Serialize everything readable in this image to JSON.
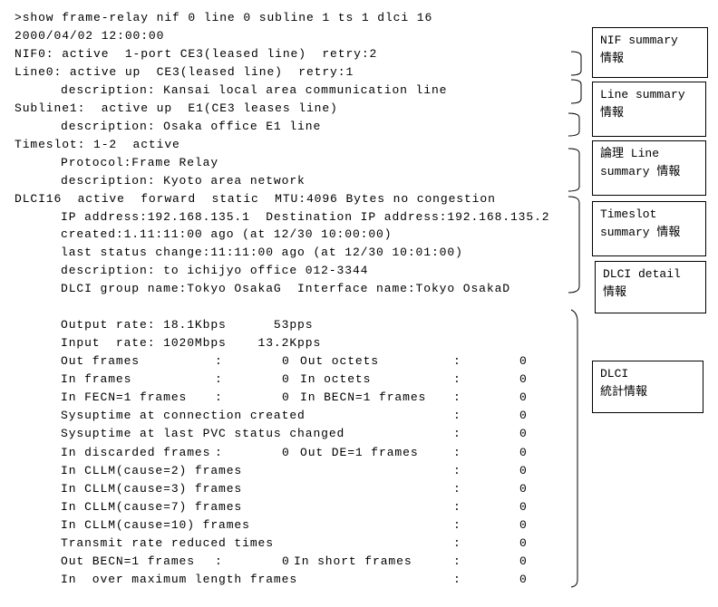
{
  "console": {
    "command": ">show frame-relay nif 0 line 0 subline 1 ts 1 dlci 16",
    "timestamp": "2000/04/02 12:00:00",
    "lines": [
      {
        "indent": false,
        "text": "NIF0: active  1-port CE3(leased line)  retry:2"
      },
      {
        "indent": false,
        "text": "Line0: active up  CE3(leased line)  retry:1"
      },
      {
        "indent": true,
        "text": "description: Kansai local area communication line"
      },
      {
        "indent": false,
        "text": "Subline1:  active up  E1(CE3 leases line)"
      },
      {
        "indent": true,
        "text": "description: Osaka office E1 line"
      },
      {
        "indent": false,
        "text": "Timeslot: 1-2  active"
      },
      {
        "indent": true,
        "text": "Protocol:Frame Relay"
      },
      {
        "indent": true,
        "text": "description: Kyoto area network"
      },
      {
        "indent": false,
        "text": "DLCI16  active  forward  static  MTU:4096 Bytes no congestion"
      },
      {
        "indent": true,
        "text": "IP address:192.168.135.1  Destination IP address:192.168.135.2"
      },
      {
        "indent": true,
        "text": "created:1.11:11:00 ago (at 12/30 10:00:00)"
      },
      {
        "indent": true,
        "text": "last status change:11:11:00 ago (at 12/30 10:01:00)"
      },
      {
        "indent": true,
        "text": "description: to ichijyo office 012-3344"
      },
      {
        "indent": true,
        "text": "DLCI group name:Tokyo OsakaG  Interface name:Tokyo OsakaD"
      }
    ],
    "rates": [
      "Output rate: 18.1Kbps      53pps",
      "Input  rate: 1020Mbps    13.2Kpps"
    ],
    "stats": [
      {
        "label": "Out frames",
        "value": "0",
        "label2": "Out octets",
        "value2": "0"
      },
      {
        "label": "In frames",
        "value": "0",
        "label2": "In octets",
        "value2": "0"
      },
      {
        "label": "In FECN=1 frames",
        "value": "0",
        "label2": "In BECN=1 frames",
        "value2": "0"
      },
      {
        "label": "Sysuptime at connection created",
        "value2": "0"
      },
      {
        "label": "Sysuptime at last PVC status changed",
        "value2": "0"
      },
      {
        "label": "In discarded frames",
        "value": "0",
        "label2": "Out DE=1 frames",
        "value2": "0"
      },
      {
        "label": "In CLLM(cause=2) frames",
        "value2": "0"
      },
      {
        "label": "In CLLM(cause=3) frames",
        "value2": "0"
      },
      {
        "label": "In CLLM(cause=7) frames",
        "value2": "0"
      },
      {
        "label": "In CLLM(cause=10) frames",
        "value2": "0"
      },
      {
        "label": "Transmit rate reduced times",
        "value2": "0"
      },
      {
        "label": "Out BECN=1 frames",
        "value": "0",
        "label2": "In short frames",
        "value2": "0"
      },
      {
        "label": "In  over maximum length frames",
        "value2": "0"
      }
    ],
    "colon": ":"
  },
  "annotations": [
    "NIF summary\n情報",
    "Line summary\n情報",
    "論理 Line\nsummary 情報",
    "Timeslot\nsummary 情報",
    "DLCI detail\n情報",
    "DLCI\n統計情報"
  ]
}
